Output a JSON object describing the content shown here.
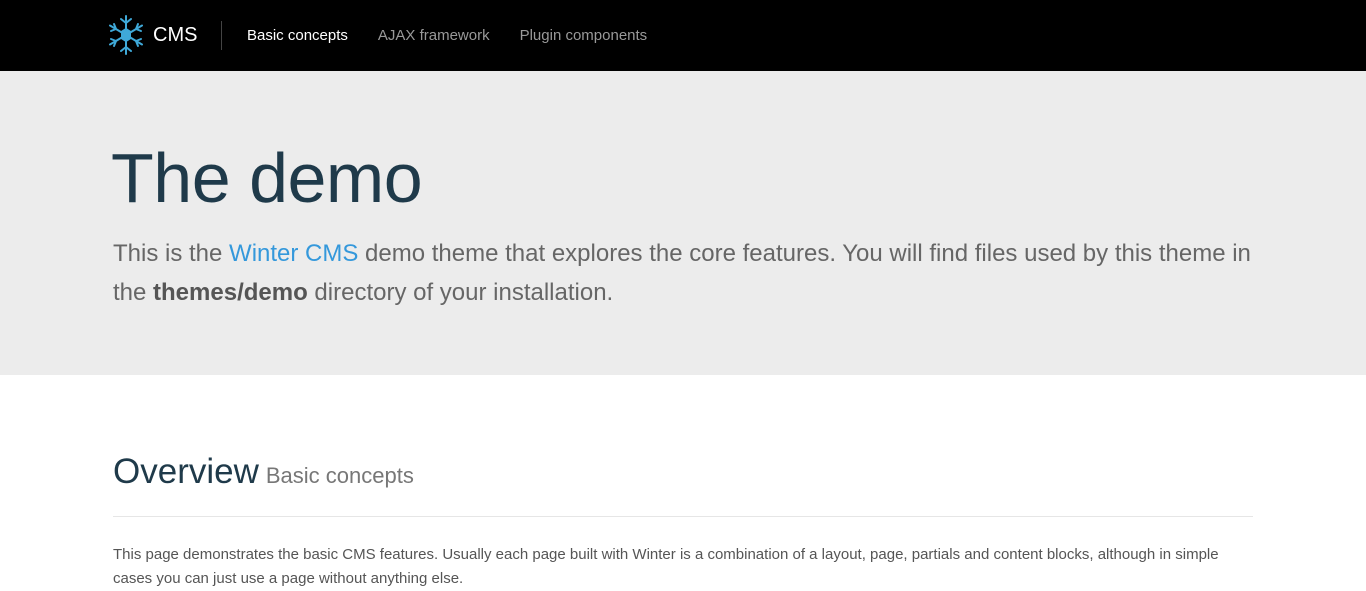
{
  "navbar": {
    "brand_text": "CMS",
    "brand_icon": "snowflake-icon",
    "links": [
      {
        "label": "Basic concepts",
        "active": true
      },
      {
        "label": "AJAX framework",
        "active": false
      },
      {
        "label": "Plugin components",
        "active": false
      }
    ]
  },
  "hero": {
    "title": "The demo",
    "lead_prefix": "This is the ",
    "lead_link": "Winter CMS",
    "lead_middle": " demo theme that explores the core features. You will find files used by this theme in the ",
    "lead_strong": "themes/demo",
    "lead_suffix": " directory of your installation."
  },
  "overview": {
    "title": "Overview",
    "subtitle": "Basic concepts",
    "text": "This page demonstrates the basic CMS features. Usually each page built with Winter is a combination of a layout, page, partials and content blocks, although in simple cases you can just use a page without anything else."
  },
  "colors": {
    "navbar_bg": "#000000",
    "hero_bg": "#ececec",
    "heading": "#1f3a4a",
    "link": "#3498db"
  }
}
